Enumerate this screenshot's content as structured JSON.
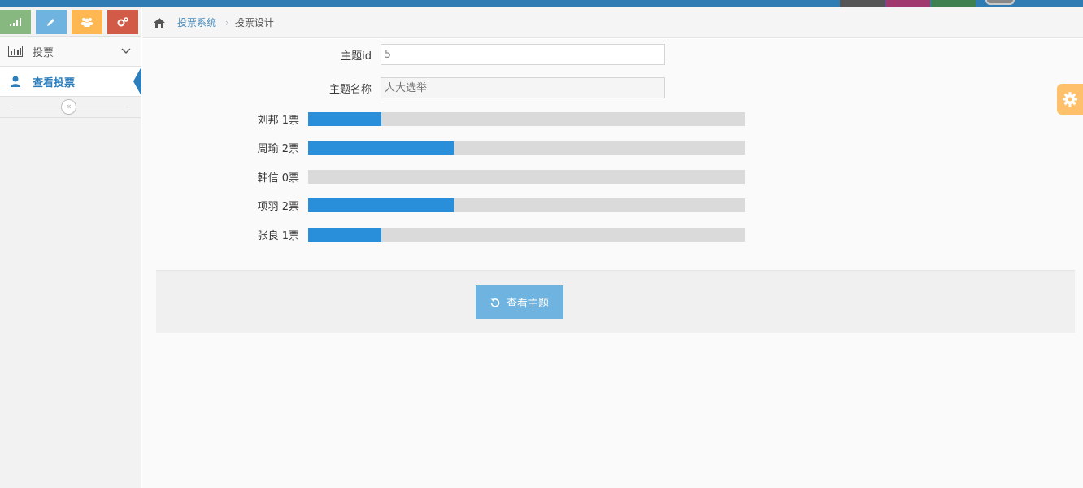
{
  "navbar": {
    "color": "#2f7cb5",
    "blocks": [
      {
        "color": "#555555"
      },
      {
        "color": "#a0396e"
      },
      {
        "color": "#3f8050"
      }
    ]
  },
  "shortcuts": [
    {
      "icon": "signal-icon",
      "color": "#87b87f"
    },
    {
      "icon": "pencil-icon",
      "color": "#6fb3e0"
    },
    {
      "icon": "users-icon",
      "color": "#ffb752"
    },
    {
      "icon": "cogs-icon",
      "color": "#d15b47"
    }
  ],
  "sidebar": {
    "items": [
      {
        "label": "投票",
        "icon": "bar-chart-icon",
        "active": false
      },
      {
        "label": "查看投票",
        "icon": "user-icon",
        "active": true
      }
    ],
    "collapse_label": "«"
  },
  "breadcrumbs": {
    "home_icon": "home-icon",
    "items": [
      "投票系统",
      "投票设计"
    ]
  },
  "form": {
    "topic_id": {
      "label": "主题id",
      "value": "5"
    },
    "topic_name": {
      "label": "主题名称",
      "placeholder": "人大选举"
    }
  },
  "votes": {
    "max": 6,
    "items": [
      {
        "label": "刘邦 1票",
        "name": "刘邦",
        "votes": 1
      },
      {
        "label": "周瑜 2票",
        "name": "周瑜",
        "votes": 2
      },
      {
        "label": "韩信 0票",
        "name": "韩信",
        "votes": 0
      },
      {
        "label": "项羽 2票",
        "name": "项羽",
        "votes": 2
      },
      {
        "label": "张良 1票",
        "name": "张良",
        "votes": 1
      }
    ],
    "fill_color": "#2a8fdb",
    "track_color": "#dadada"
  },
  "actions": {
    "view_topic_label": "查看主题",
    "view_topic_icon": "undo-icon"
  },
  "settings": {
    "icon": "gear-icon",
    "color": "#ffb752"
  }
}
